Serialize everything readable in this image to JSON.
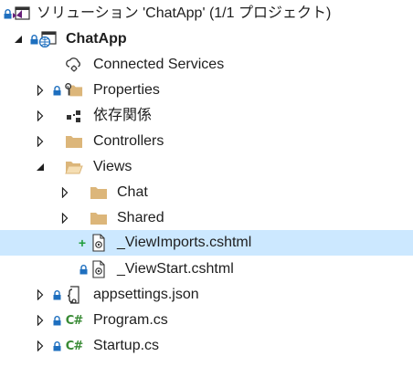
{
  "tree": {
    "solution": {
      "label": "ソリューション 'ChatApp' (1/1 プロジェクト)",
      "icon": "solution-icon"
    },
    "project": {
      "label": "ChatApp",
      "icon": "web-project-icon",
      "expanded": true
    },
    "connected_services": {
      "label": "Connected Services",
      "icon": "cloud-gear-icon"
    },
    "properties": {
      "label": "Properties",
      "icon": "properties-folder-icon"
    },
    "dependencies": {
      "label": "依存関係",
      "icon": "dependencies-icon"
    },
    "controllers": {
      "label": "Controllers",
      "icon": "folder-icon"
    },
    "views": {
      "label": "Views",
      "icon": "folder-open-icon",
      "expanded": true
    },
    "chat": {
      "label": "Chat",
      "icon": "folder-icon"
    },
    "shared": {
      "label": "Shared",
      "icon": "folder-icon"
    },
    "viewimports": {
      "label": "_ViewImports.cshtml",
      "icon": "razor-file-icon",
      "selected": true,
      "status": "added"
    },
    "viewstart": {
      "label": "_ViewStart.cshtml",
      "icon": "razor-file-icon"
    },
    "appsettings": {
      "label": "appsettings.json",
      "icon": "json-file-icon"
    },
    "program": {
      "label": "Program.cs",
      "icon": "csharp-file-icon",
      "icon_text": "C#"
    },
    "startup": {
      "label": "Startup.cs",
      "icon": "csharp-file-icon",
      "icon_text": "C#"
    }
  },
  "colors": {
    "selection": "#cce8ff",
    "folder": "#dcb67a",
    "lock": "#1e6fbf",
    "added": "#1f9d3a",
    "csharp": "#388a34"
  }
}
